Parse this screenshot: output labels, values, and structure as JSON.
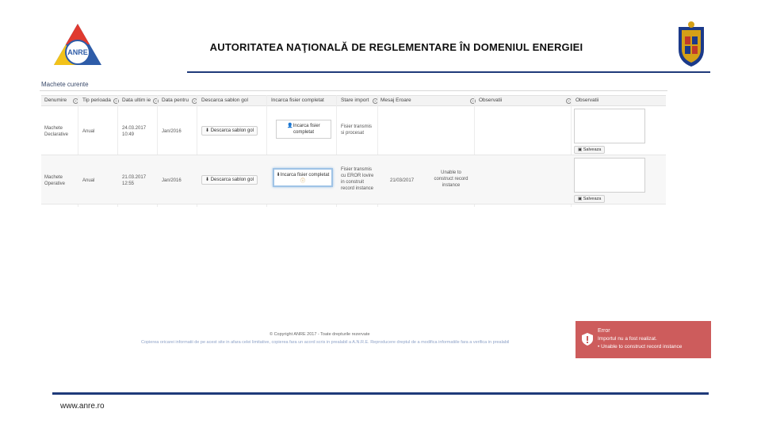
{
  "header": {
    "logo_text": "ANRE",
    "title": "AUTORITATEA NAŢIONALĂ DE REGLEMENTARE ÎN DOMENIUL ENERGIEI"
  },
  "panel": {
    "title": "Machete curente",
    "columns": [
      "Denumire ma",
      "Tip perioada",
      "Data ultim ie",
      "Data pentru i",
      "Descarca sablon gol",
      "Incarca fisier completat",
      "Stare import",
      "Mesaj Eroare",
      "Observatii",
      "Observatii"
    ],
    "rows": [
      {
        "name": "Machete Declarative",
        "period": "Anual",
        "date": "24.03.2017 10:49",
        "for_period": "Jan/2016",
        "download_label": "Descarca sablon gol",
        "upload_label": "Incarca fisier completat",
        "status": "Fisier transmis si procesat",
        "error_date": "",
        "error_msg": "",
        "save_label": "Salveaza"
      },
      {
        "name": "Machete Operative",
        "period": "Anual",
        "date": "21.03.2017 12:55",
        "for_period": "Jan/2016",
        "download_label": "Descarca sablon gol",
        "upload_label": "Incarca fisier completat",
        "status": "Fisier transmis cu EROR lovire in construit record instance",
        "error_date": "21/03/2017",
        "error_msg": "Unable to construct record instance",
        "save_label": "Salveaza"
      }
    ]
  },
  "footer_shot": {
    "copyright": "© Copyright ANRE 2017 - Toate drepturile rezervate",
    "notice": "Copierea oricarei informatii de pe acest site in afara celei limitative, copierea fara un acord scris in prealabil a A.N.R.E. Reproducere dreptul de a modifica informatiile fara a verifica in prealabil"
  },
  "toast": {
    "title": "Error",
    "line1": "Importul nu a fost realizat.",
    "line2": "Unable to construct record instance",
    "color": "#cd5c5c"
  },
  "footer": {
    "url": "www.anre.ro"
  }
}
